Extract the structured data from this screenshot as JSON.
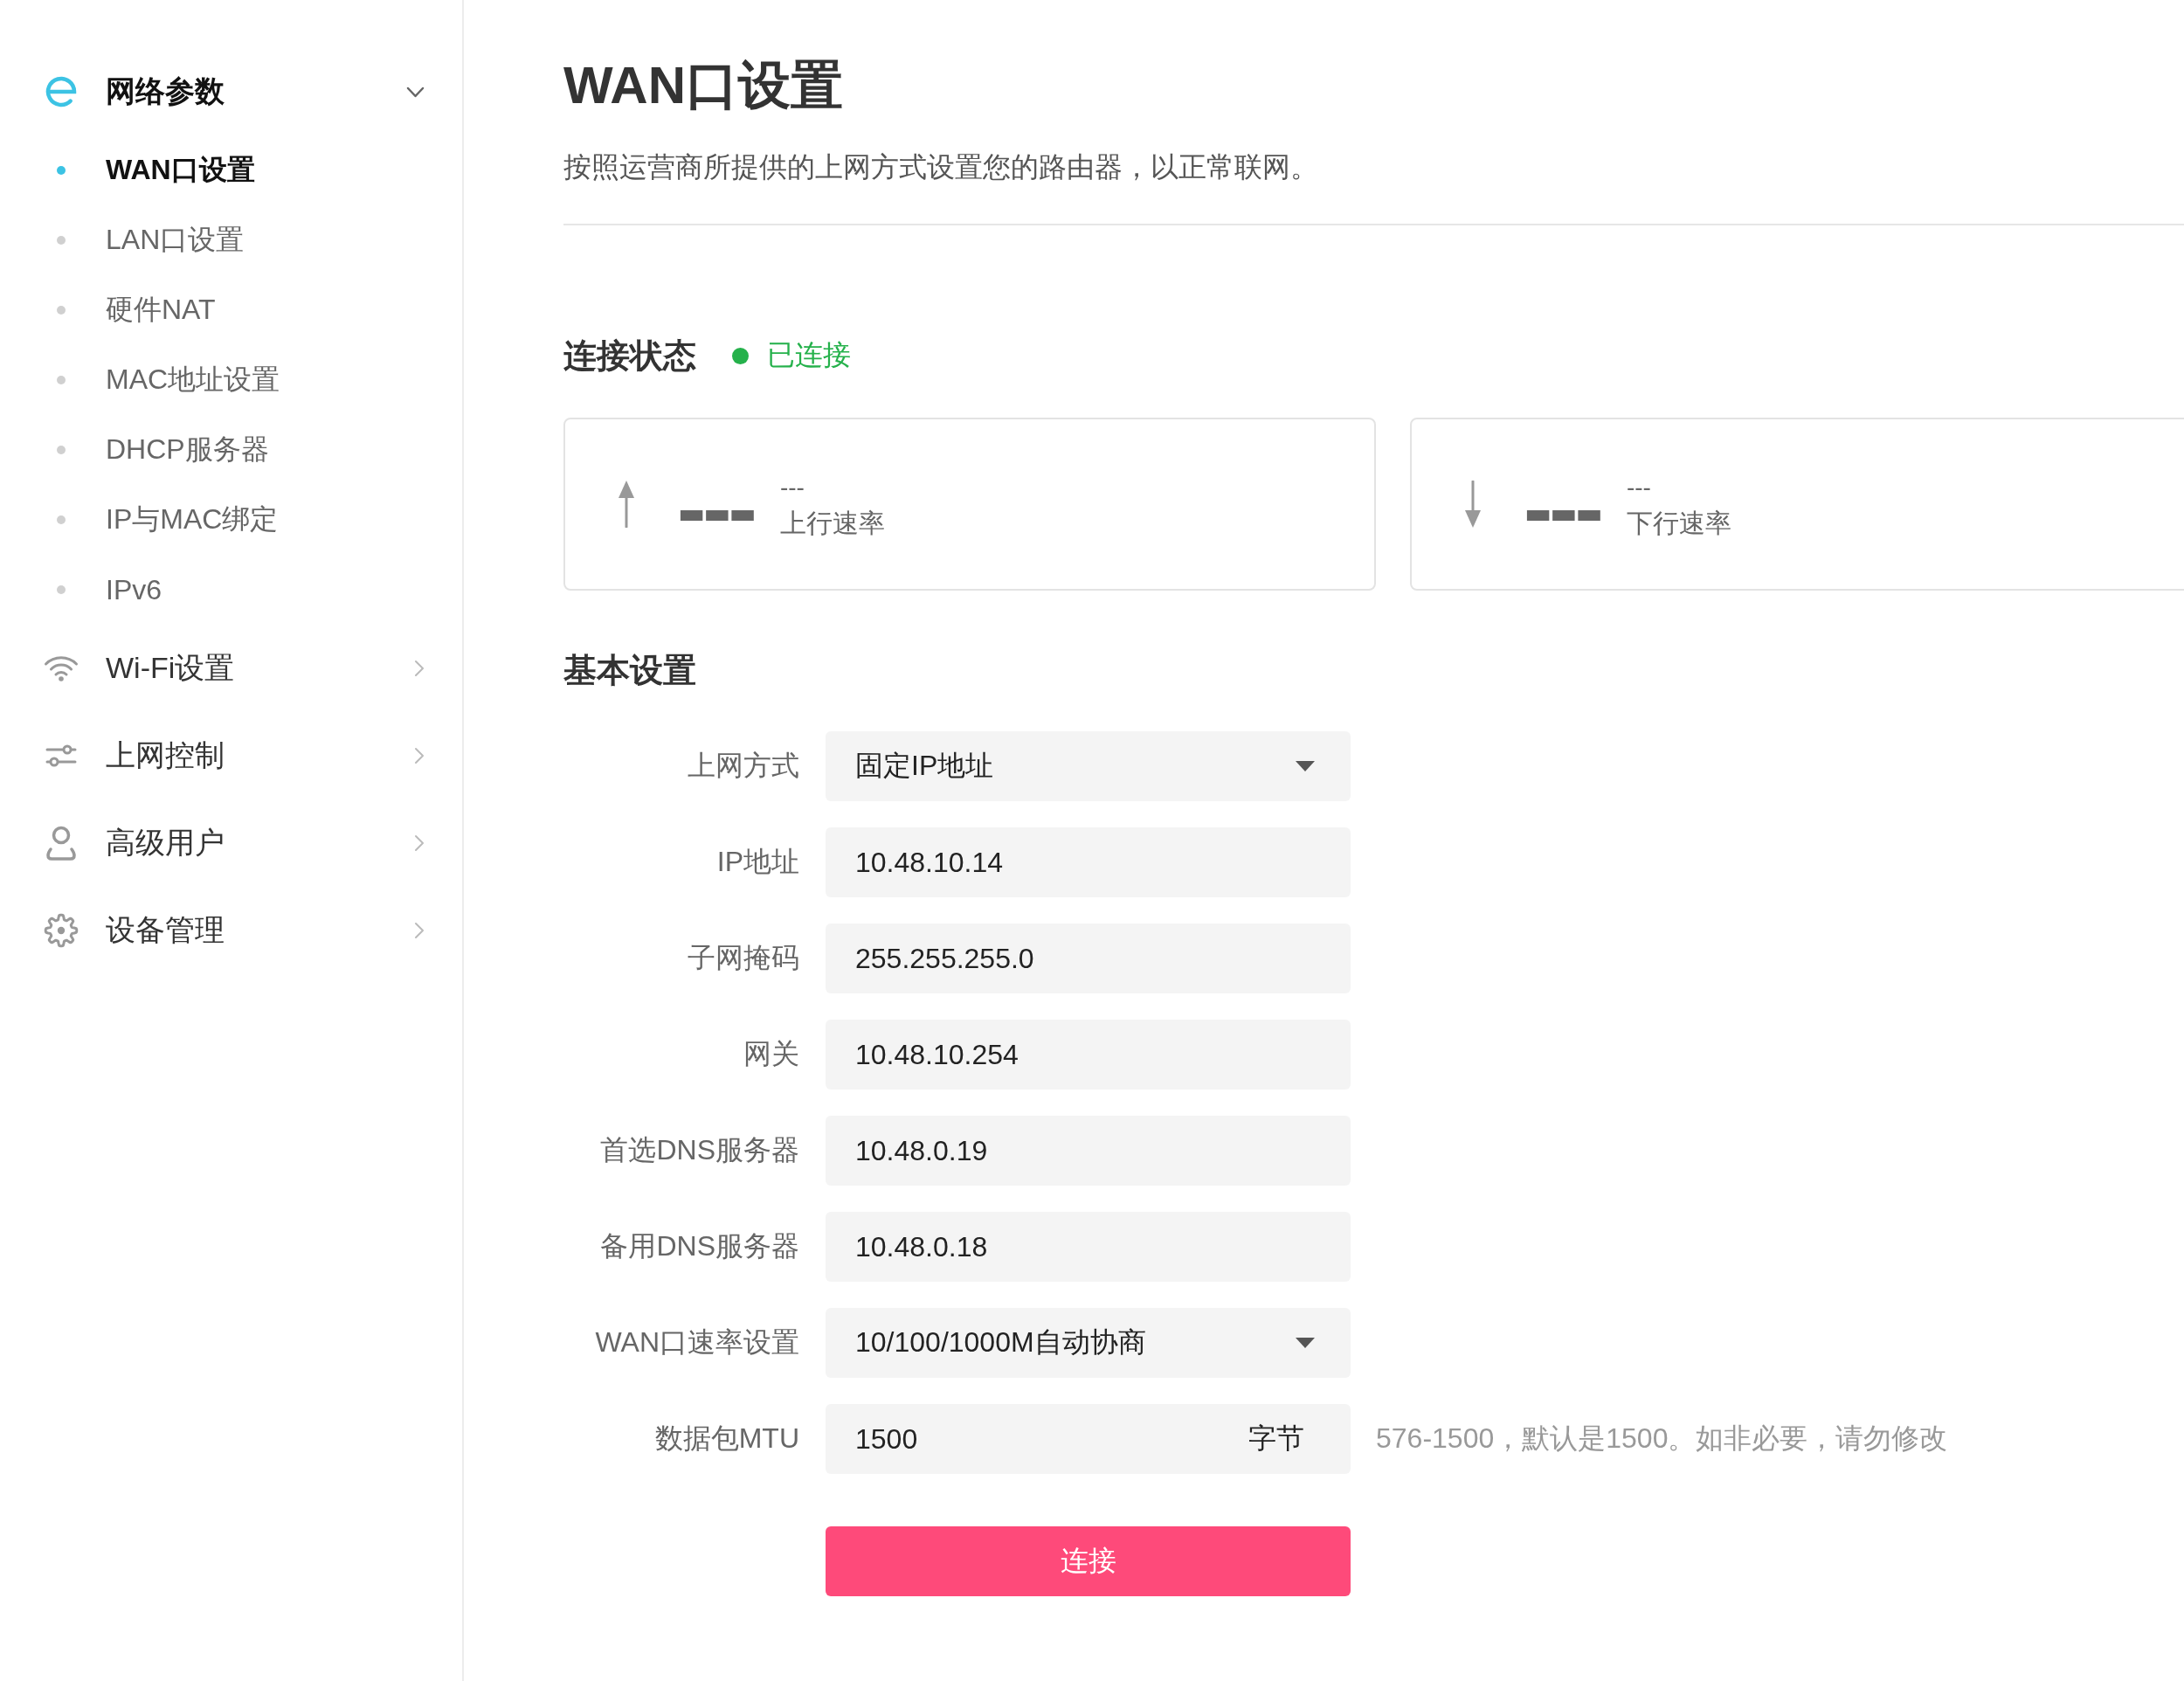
{
  "sidebar": {
    "groups": [
      {
        "label": "网络参数",
        "expanded": true,
        "children": [
          {
            "label": "WAN口设置",
            "selected": true
          },
          {
            "label": "LAN口设置",
            "selected": false
          },
          {
            "label": "硬件NAT",
            "selected": false
          },
          {
            "label": "MAC地址设置",
            "selected": false
          },
          {
            "label": "DHCP服务器",
            "selected": false
          },
          {
            "label": "IP与MAC绑定",
            "selected": false
          },
          {
            "label": "IPv6",
            "selected": false
          }
        ]
      },
      {
        "label": "Wi-Fi设置",
        "expanded": false
      },
      {
        "label": "上网控制",
        "expanded": false
      },
      {
        "label": "高级用户",
        "expanded": false
      },
      {
        "label": "设备管理",
        "expanded": false
      }
    ]
  },
  "page": {
    "title": "WAN口设置",
    "description": "按照运营商所提供的上网方式设置您的路由器，以正常联网。"
  },
  "connection": {
    "heading": "连接状态",
    "status": "已连接",
    "connected": true
  },
  "speed_cards": [
    {
      "kind": "upload",
      "value": "---",
      "unit": "---",
      "label": "上行速率"
    },
    {
      "kind": "download",
      "value": "---",
      "unit": "---",
      "label": "下行速率"
    }
  ],
  "basic_settings": {
    "heading": "基本设置",
    "fields": [
      {
        "kind": "select",
        "label": "上网方式",
        "value": "固定IP地址"
      },
      {
        "kind": "text",
        "label": "IP地址",
        "value": "10.48.10.14"
      },
      {
        "kind": "text",
        "label": "子网掩码",
        "value": "255.255.255.0"
      },
      {
        "kind": "text",
        "label": "网关",
        "value": "10.48.10.254"
      },
      {
        "kind": "text",
        "label": "首选DNS服务器",
        "value": "10.48.0.19"
      },
      {
        "kind": "text",
        "label": "备用DNS服务器",
        "value": "10.48.0.18"
      },
      {
        "kind": "select",
        "label": "WAN口速率设置",
        "value": "10/100/1000M自动协商"
      },
      {
        "kind": "text",
        "label": "数据包MTU",
        "value": "1500",
        "suffix": "字节",
        "hint": "576-1500，默认是1500。如非必要，请勿修改"
      }
    ],
    "submit": "连接"
  }
}
